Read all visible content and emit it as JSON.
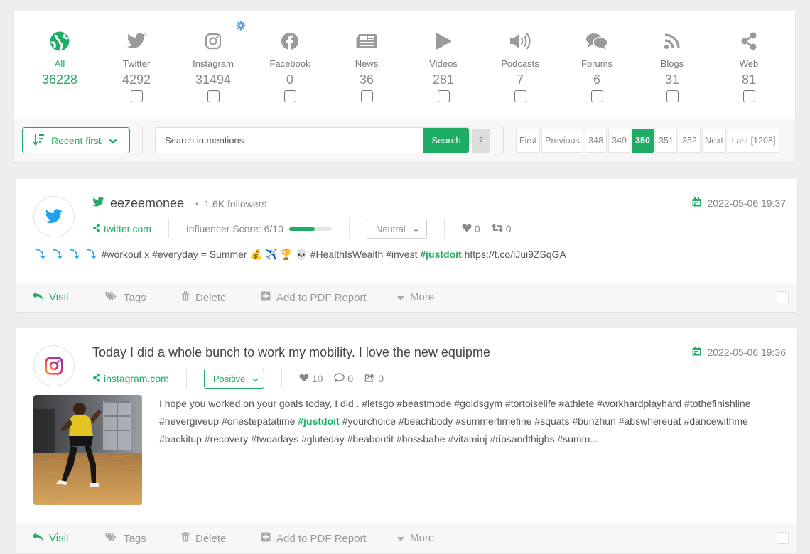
{
  "sources": [
    {
      "label": "All",
      "count": "36228",
      "icon": "globe-icon",
      "active": true
    },
    {
      "label": "Twitter",
      "count": "4292",
      "icon": "twitter-icon"
    },
    {
      "label": "Instagram",
      "count": "31494",
      "icon": "instagram-icon"
    },
    {
      "label": "Facebook",
      "count": "0",
      "icon": "facebook-icon"
    },
    {
      "label": "News",
      "count": "36",
      "icon": "newspaper-icon"
    },
    {
      "label": "Videos",
      "count": "281",
      "icon": "play-icon"
    },
    {
      "label": "Podcasts",
      "count": "7",
      "icon": "speaker-icon"
    },
    {
      "label": "Forums",
      "count": "6",
      "icon": "chat-icon"
    },
    {
      "label": "Blogs",
      "count": "31",
      "icon": "rss-icon"
    },
    {
      "label": "Web",
      "count": "81",
      "icon": "share-icon"
    }
  ],
  "toolbar": {
    "sort_label": "Recent first",
    "search_placeholder": "Search in mentions",
    "search_button": "Search",
    "help_button": "?"
  },
  "pagination": [
    "First",
    "Previous",
    "348",
    "349",
    "350",
    "351",
    "352",
    "Next",
    "Last [1208]"
  ],
  "pagination_current": "350",
  "colors": {
    "accent": "#1fad65",
    "twitter": "#1da1f2"
  },
  "mentions": [
    {
      "author": "eezeemonee",
      "followers": "1.6K followers",
      "date": "2022-05-06 19:37",
      "domain": "twitter.com",
      "influencer_label": "Influencer Score: 6/10",
      "influencer_score": 6,
      "influencer_max": 10,
      "sentiment": "Neutral",
      "likes": "0",
      "retweets": "0",
      "text_before": "#workout x #everyday = Summer 💰 ✈️ 🏆 💀 #HealthIsWealth #invest ",
      "highlight": "#justdoit",
      "text_after": " https://t.co/lJui9ZSqGA"
    },
    {
      "title": "Today I did a whole bunch to work my mobility. I love the new equipme",
      "date": "2022-05-06 19:36",
      "domain": "instagram.com",
      "sentiment": "Positive",
      "likes": "10",
      "comments": "0",
      "shares": "0",
      "text_before": "I hope you worked on your goals today, I did . #letsgo #beastmode #goldsgym #tortoiselife #athlete #workhardplayhard #tothefinishline #nevergiveup #onestepatatime ",
      "highlight": "#justdoit",
      "text_after": " #yourchoice #beachbody #summertimefine #squats #bunzhun #abswhereuat #dancewithme #backitup #recovery #twoadays #gluteday #beaboutit #bossbabe #vitaminj #ribsandthighs #summ..."
    }
  ],
  "actions": {
    "visit": "Visit",
    "tags": "Tags",
    "delete": "Delete",
    "pdf": "Add to PDF Report",
    "more": "More"
  }
}
